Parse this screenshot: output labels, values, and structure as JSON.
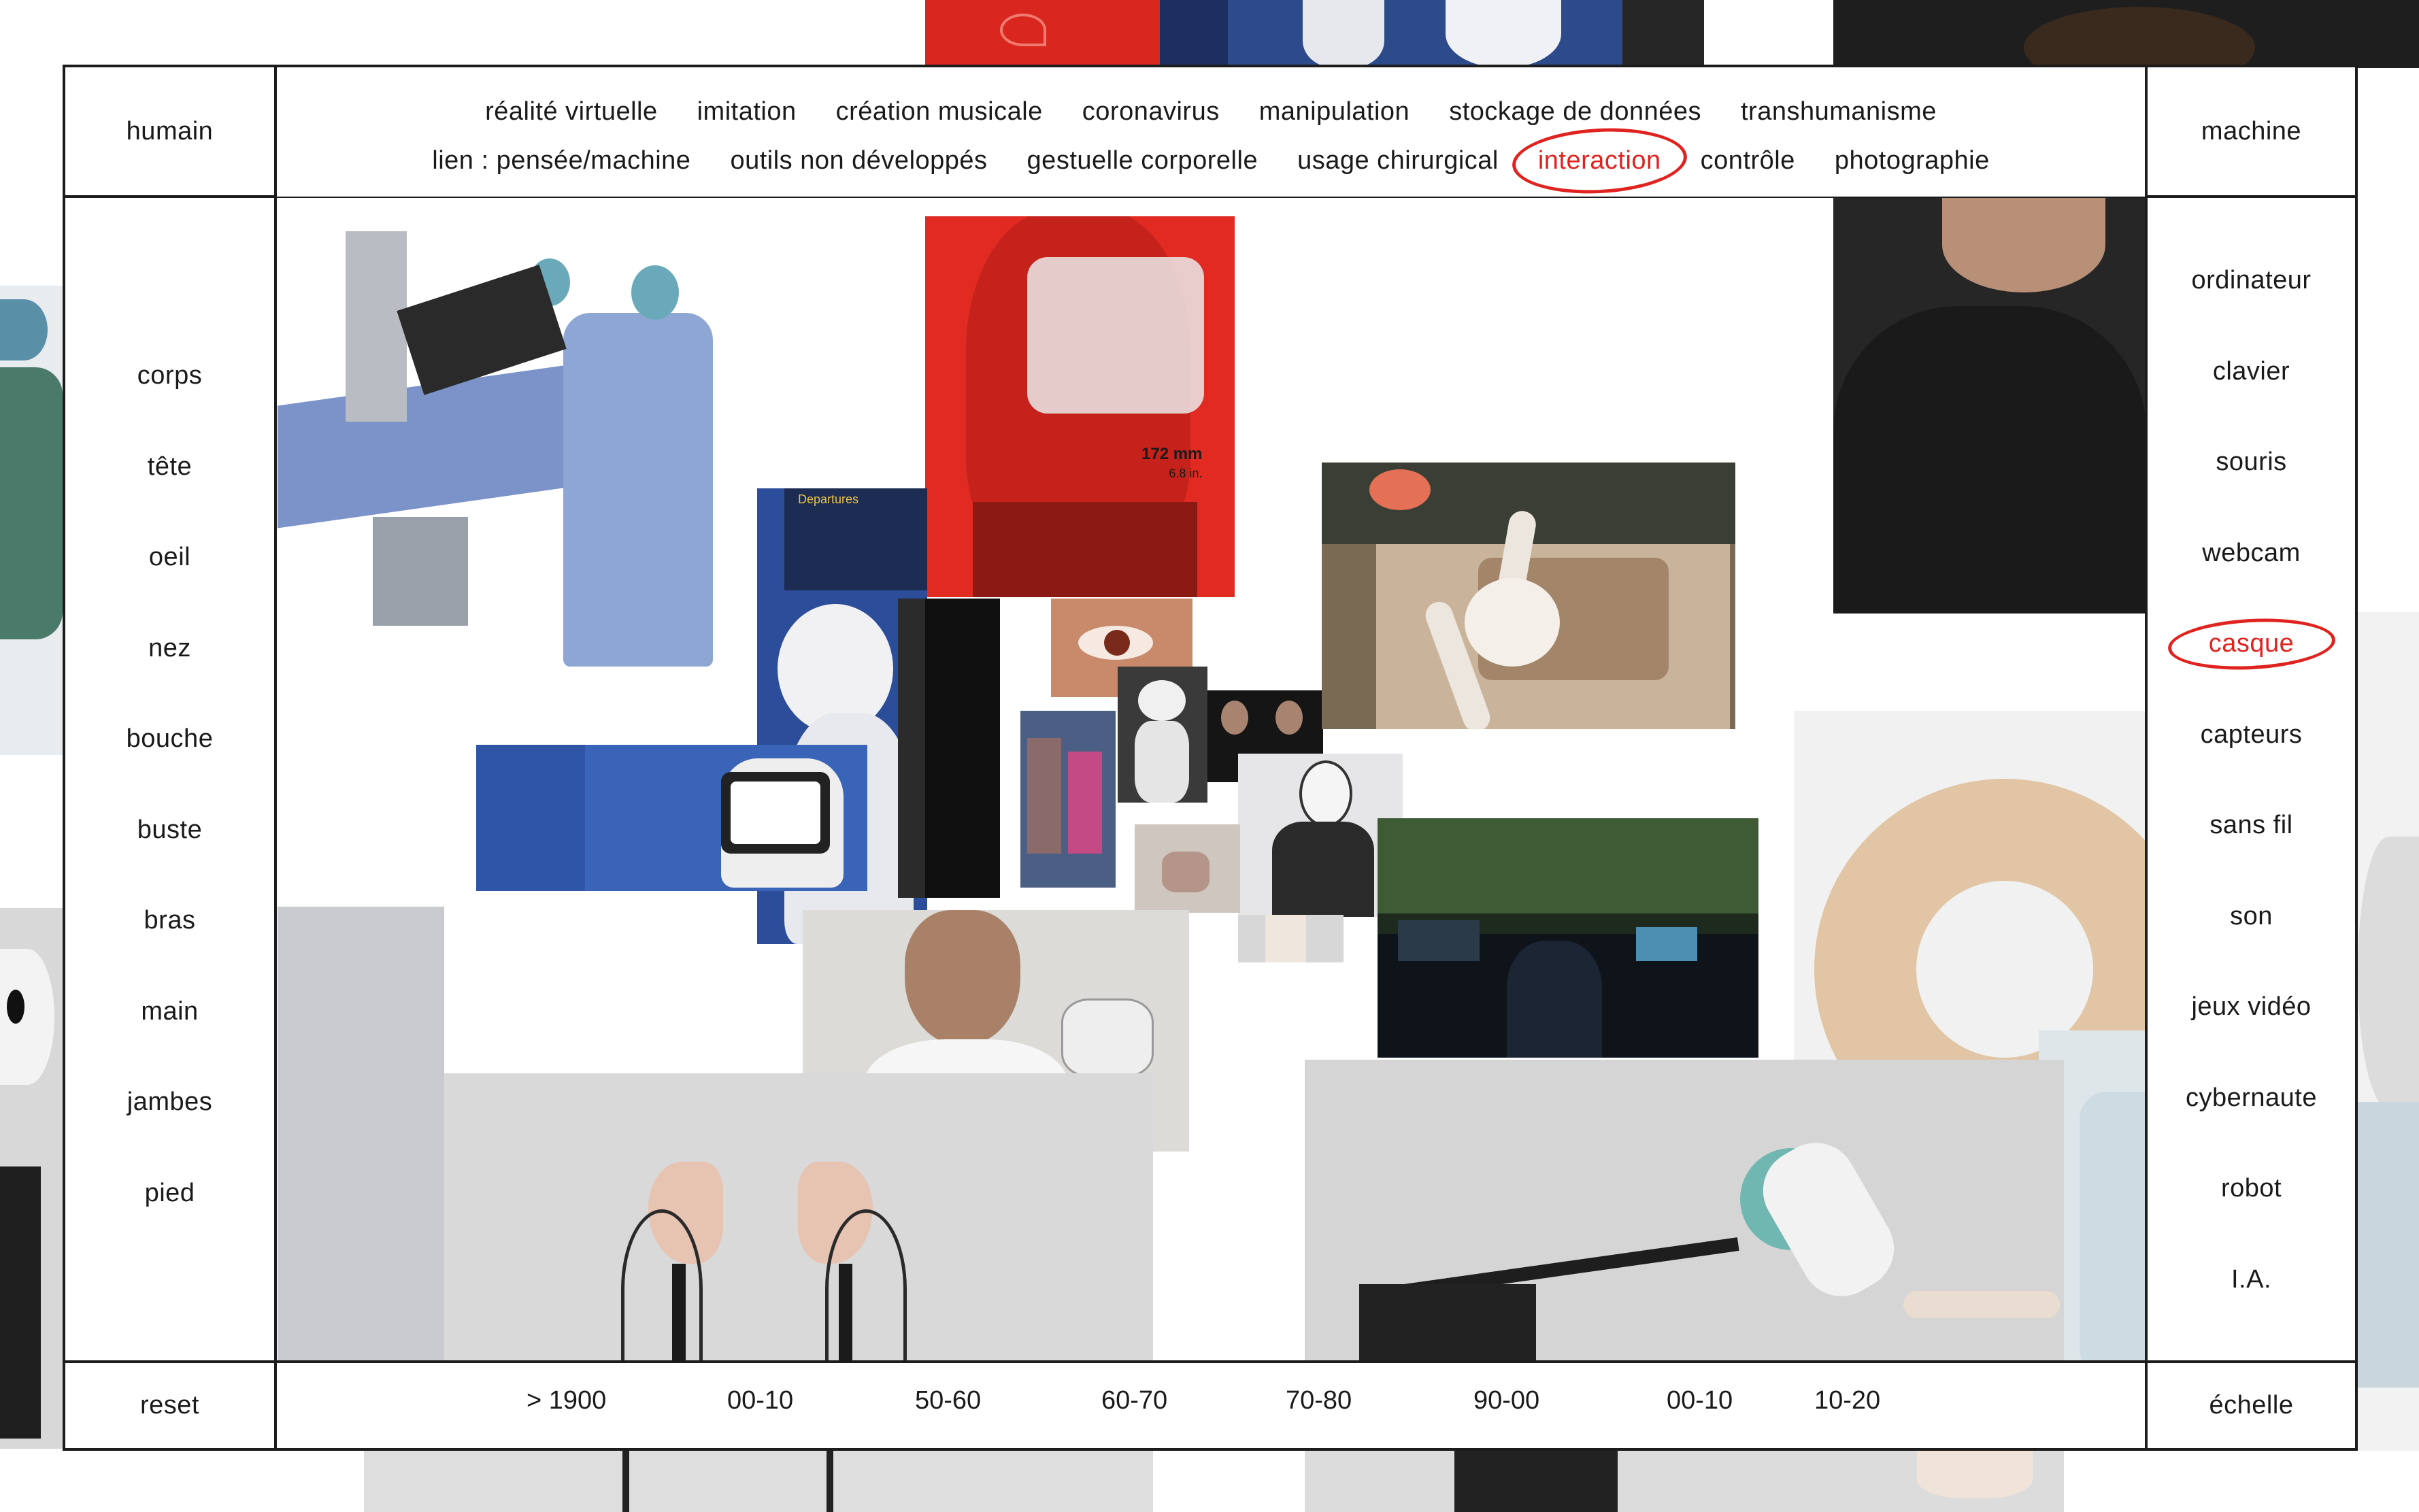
{
  "header": {
    "left_title": "humain",
    "right_title": "machine"
  },
  "tags": {
    "row1": [
      "réalité virtuelle",
      "imitation",
      "création musicale",
      "coronavirus",
      "manipulation",
      "stockage de données",
      "transhumanisme"
    ],
    "row2": [
      "lien : pensée/machine",
      "outils non développés",
      "gestuelle corporelle",
      "usage chirurgical",
      "interaction",
      "contrôle",
      "photographie"
    ],
    "active": "interaction"
  },
  "human_parts": [
    "corps",
    "tête",
    "oeil",
    "nez",
    "bouche",
    "buste",
    "bras",
    "main",
    "jambes",
    "pied"
  ],
  "machine_parts": [
    "ordinateur",
    "clavier",
    "souris",
    "webcam",
    "casque",
    "capteurs",
    "sans fil",
    "son",
    "jeux vidéo",
    "cybernaute",
    "robot",
    "I.A."
  ],
  "machine_active": "casque",
  "footer": {
    "reset_label": "reset",
    "scale_label": "échelle",
    "periods": [
      "> 1900",
      "00-10",
      "50-60",
      "60-70",
      "70-80",
      "90-00",
      "00-10",
      "10-20"
    ]
  },
  "headset_photo": {
    "measure": "172 mm",
    "measure_sub": "6.8 in."
  },
  "departures_board": {
    "title": "Departures"
  },
  "colors": {
    "accent": "#e0231f",
    "border": "#1c1c1c",
    "text": "#1a1a1a",
    "background": "#ffffff"
  }
}
